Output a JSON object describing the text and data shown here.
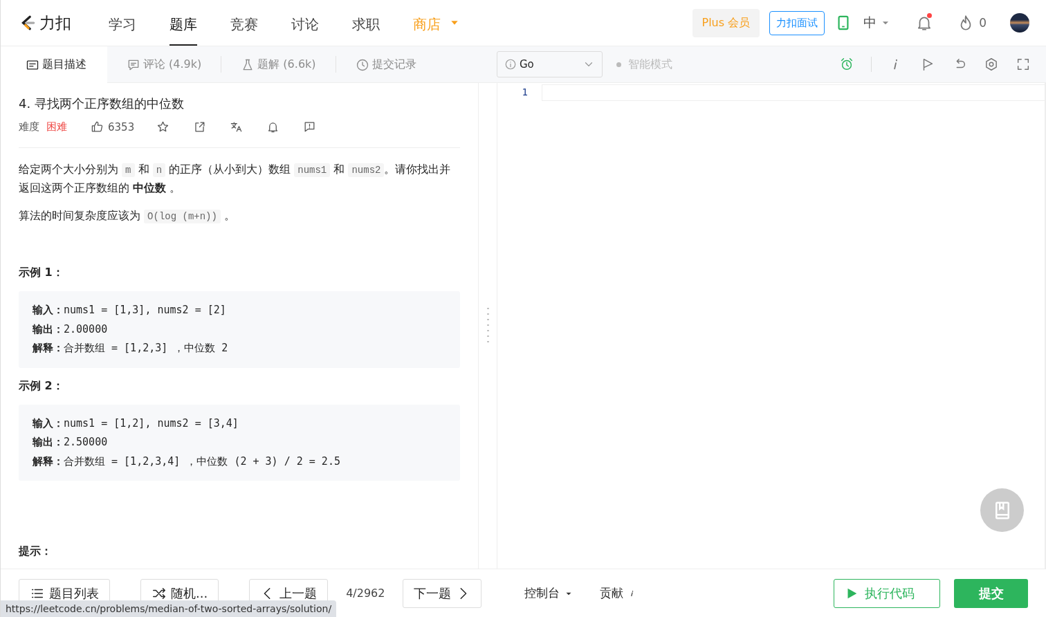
{
  "nav": {
    "logo": "力扣",
    "items": [
      {
        "label": "学习",
        "selected": false
      },
      {
        "label": "题库",
        "selected": true
      },
      {
        "label": "竞赛",
        "selected": false
      },
      {
        "label": "讨论",
        "selected": false
      },
      {
        "label": "求职",
        "selected": false
      },
      {
        "label": "商店",
        "selected": false,
        "kind": "highlight"
      }
    ],
    "plus": "Plus 会员",
    "interview": "力扣面试",
    "lang": "中",
    "notifications_unread": true,
    "points": "0"
  },
  "tabs": [
    {
      "label": "题目描述",
      "selected": true
    },
    {
      "label": "评论 (4.9k)",
      "selected": false
    },
    {
      "label": "题解 (6.6k)",
      "selected": false
    },
    {
      "label": "提交记录",
      "selected": false
    }
  ],
  "editor_toolbar": {
    "language": "Go",
    "mode": "智能模式"
  },
  "problem": {
    "title": "4. 寻找两个正序数组的中位数",
    "difficulty_label": "难度",
    "difficulty": "困难",
    "likes": "6353",
    "paragraphs": [
      [
        {
          "kind": "text",
          "text": "给定两个大小分别为 "
        },
        {
          "kind": "code",
          "text": "m"
        },
        {
          "kind": "text",
          "text": " 和 "
        },
        {
          "kind": "code",
          "text": "n"
        },
        {
          "kind": "text",
          "text": " 的正序（从小到大）数组 "
        },
        {
          "kind": "code",
          "text": "nums1"
        },
        {
          "kind": "text",
          "text": " 和 "
        },
        {
          "kind": "code",
          "text": "nums2"
        },
        {
          "kind": "text",
          "text": "。请你找出并返回这两个正序数组的 "
        },
        {
          "kind": "bold",
          "text": "中位数"
        },
        {
          "kind": "text",
          "text": " 。"
        }
      ],
      [
        {
          "kind": "text",
          "text": "算法的时间复杂度应该为 "
        },
        {
          "kind": "code",
          "text": "O(log (m+n))"
        },
        {
          "kind": "text",
          "text": " 。"
        }
      ]
    ],
    "examples": [
      {
        "title": "示例 1：",
        "lines": [
          "**输入：**nums1 = [1,3], nums2 = [2]",
          "**输出：**2.00000",
          "**解释：**合并数组 = [1,2,3] ，中位数 2"
        ]
      },
      {
        "title": "示例 2：",
        "lines": [
          "**输入：**nums1 = [1,2], nums2 = [3,4]",
          "**输出：**2.50000",
          "**解释：**合并数组 = [1,2,3,4] ，中位数 (2 + 3) / 2 = 2.5"
        ]
      }
    ],
    "hint_title": "提示："
  },
  "editor": {
    "line_numbers": [
      "1"
    ]
  },
  "bottom": {
    "problem_list": "题目列表",
    "random": "随机...",
    "prev": "上一题",
    "counter": "4/2962",
    "next": "下一题",
    "console": "控制台",
    "contribute": "贡献",
    "run": "执行代码",
    "submit": "提交"
  },
  "status_bar": {
    "url": "https://leetcode.cn/problems/median-of-two-sorted-arrays/solution/"
  }
}
